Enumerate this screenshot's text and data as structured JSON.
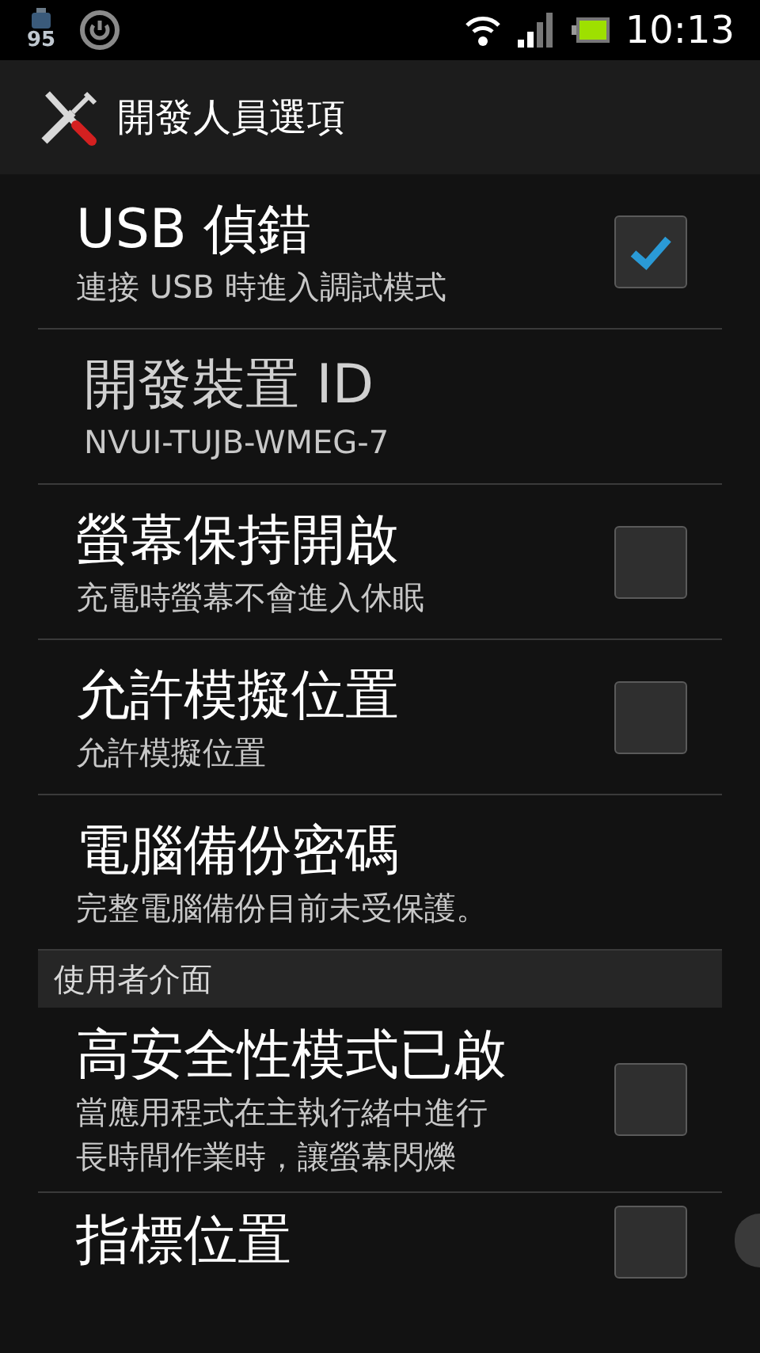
{
  "status_bar": {
    "badge": "95",
    "time": "10:13"
  },
  "title": "開發人員選項",
  "items": [
    {
      "kind": "checkbox",
      "title": "USB 偵錯",
      "summary": [
        "連接 USB 時進入調試模式"
      ],
      "checked": true
    },
    {
      "kind": "info",
      "title": "開發裝置 ID",
      "summary": [
        "NVUI-TUJB-WMEG-7"
      ]
    },
    {
      "kind": "checkbox",
      "title": "螢幕保持開啟",
      "summary": [
        "充電時螢幕不會進入休眠"
      ],
      "checked": false
    },
    {
      "kind": "checkbox",
      "title": "允許模擬位置",
      "summary": [
        "允許模擬位置"
      ],
      "checked": false
    },
    {
      "kind": "action",
      "title": "電腦備份密碼",
      "summary": [
        "完整電腦備份目前未受保護。"
      ]
    },
    {
      "kind": "header",
      "title": "使用者介面"
    },
    {
      "kind": "checkbox",
      "title": "高安全性模式已啟",
      "summary": [
        "當應用程式在主執行緒中進行",
        "長時間作業時，讓螢幕閃爍"
      ],
      "checked": false
    },
    {
      "kind": "checkbox",
      "title": "指標位置",
      "checked": false
    }
  ]
}
